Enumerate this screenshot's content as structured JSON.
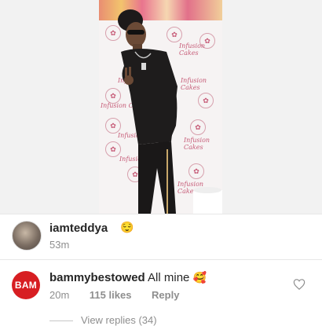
{
  "post": {
    "author": {
      "username": "iamteddya",
      "emoji": "😌",
      "time": "53m"
    },
    "photo_banner_text": "Infusion Cakes"
  },
  "comments": [
    {
      "avatar_text": "BAM",
      "username": "bammybestowed",
      "text": "All mine",
      "emoji": "🥰",
      "time": "20m",
      "likes": "115 likes",
      "reply_label": "Reply"
    }
  ],
  "view_replies_label": "View replies (34)",
  "colors": {
    "avatar_bam": "#d71e22",
    "meta_text": "#8e8e8e"
  },
  "icons": [
    "heart-icon"
  ]
}
